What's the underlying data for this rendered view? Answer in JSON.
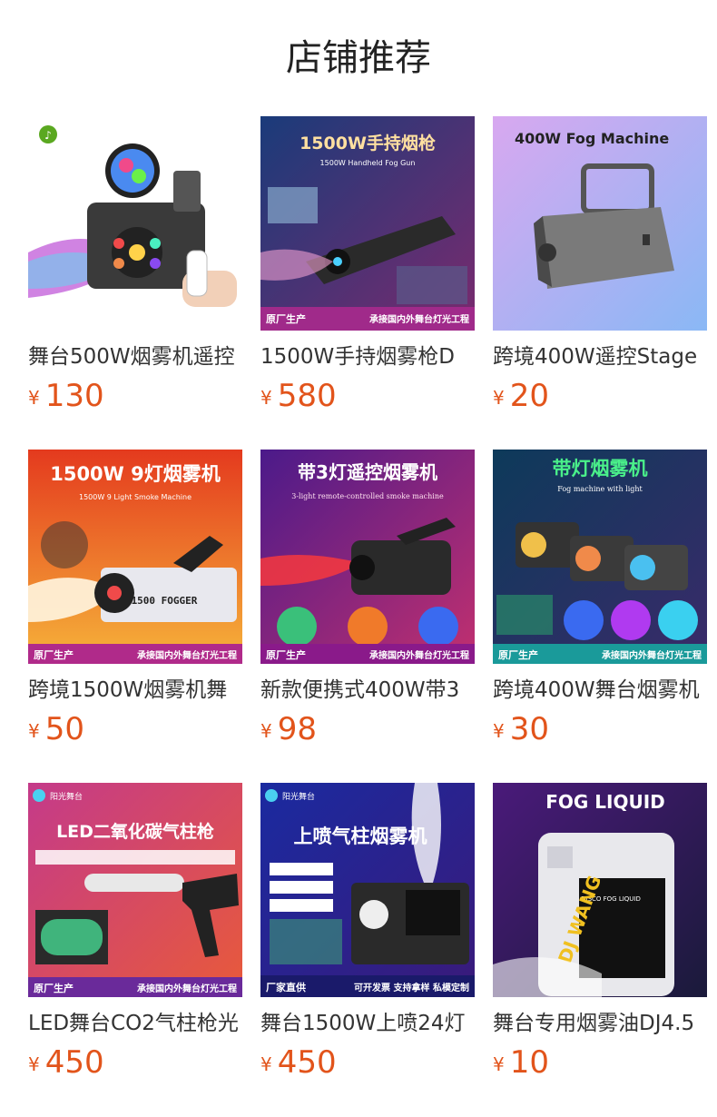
{
  "section_title": "店铺推荐",
  "currency": "¥",
  "products": [
    {
      "name": "舞台500W烟雾机遥控",
      "price": "130",
      "image_text": "",
      "bg": [
        "#ffffff",
        "#f4f4f4"
      ]
    },
    {
      "name": "1500W手持烟雾枪D",
      "price": "580",
      "image_text": "1500W手持烟枪",
      "image_sub": "1500W Handheld Fog Gun",
      "bottom_left": "原厂生产",
      "bottom_right": "承接国内外舞台灯光工程",
      "bg": [
        "#1a3b7a",
        "#7a2a6e"
      ]
    },
    {
      "name": "跨境400W遥控Stage",
      "price": "20",
      "image_text": "400W Fog Machine",
      "bg": [
        "#c8a6f0",
        "#8db4f5"
      ]
    },
    {
      "name": "跨境1500W烟雾机舞",
      "price": "50",
      "image_text": "1500W 9灯烟雾机",
      "image_sub": "1500W 9 Light Smoke Machine",
      "bottom_left": "原厂生产",
      "bottom_right": "承接国内外舞台灯光工程",
      "bg": [
        "#e43a1e",
        "#f6b33a"
      ]
    },
    {
      "name": "新款便携式400W带3",
      "price": "98",
      "image_text": "带3灯遥控烟雾机",
      "image_sub": "3-light remote-controlled smoke machine",
      "bottom_left": "原厂生产",
      "bottom_right": "承接国内外舞台灯光工程",
      "bg": [
        "#4b1a8a",
        "#c2306f"
      ]
    },
    {
      "name": "跨境400W舞台烟雾机",
      "price": "30",
      "image_text": "带灯烟雾机",
      "image_sub": "Fog machine with light",
      "bottom_left": "原厂生产",
      "bottom_right": "承接国内外舞台灯光工程",
      "bg": [
        "#0d3a5a",
        "#3a2a6a"
      ]
    },
    {
      "name": "LED舞台CO2气柱枪光",
      "price": "450",
      "image_text": "LED二氧化碳气柱枪",
      "brand": "阳光舞台",
      "bottom_left": "原厂生产",
      "bottom_right": "承接国内外舞台灯光工程",
      "bg": [
        "#c43a8a",
        "#e85a3a"
      ]
    },
    {
      "name": "舞台1500W上喷24灯",
      "price": "450",
      "image_text": "上喷气柱烟雾机",
      "brand": "阳光舞台",
      "bottom_left": "厂家直供",
      "bottom_right": "可开发票 支持拿样 私模定制",
      "bg": [
        "#1a2aa0",
        "#3a1a7a"
      ]
    },
    {
      "name": "舞台专用烟雾油DJ4.5",
      "price": "10",
      "image_text": "FOG LIQUID",
      "label_text": "DJ WANG",
      "bg": [
        "#4a1a7a",
        "#1a1a3a"
      ]
    }
  ]
}
